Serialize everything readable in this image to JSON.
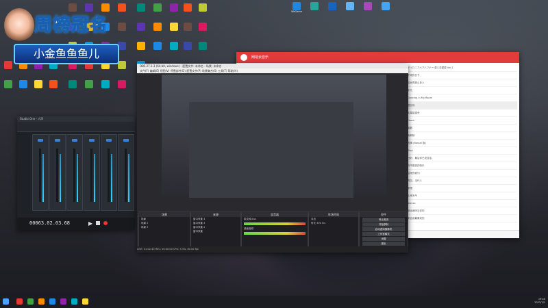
{
  "overlay": {
    "title": "周榜冠名",
    "subtitle": "小金鱼鱼鱼儿"
  },
  "desktop": {
    "top_icons": [
      {
        "label": "WeGame",
        "color": "#1e88e5"
      },
      {
        "label": "",
        "color": "#26a69a"
      },
      {
        "label": "",
        "color": "#1565c0"
      },
      {
        "label": "",
        "color": "#64b5f6"
      },
      {
        "label": "",
        "color": "#ab47bc"
      },
      {
        "label": "",
        "color": "#42a5f5"
      }
    ],
    "left_icon_colors": [
      "#e53935",
      "#43a047",
      "#fb8c00",
      "#1e88e5",
      "#8e24aa",
      "#fdd835",
      "#00acc1",
      "#f4511e",
      "#6d4c41",
      "#3949ab",
      "#c0ca33",
      "#d81b60",
      "#00897b",
      "#5e35b1",
      "#ffb300",
      "#039be5"
    ]
  },
  "studio_one": {
    "title": "Studio One - 人声",
    "time": "00063.02.03.68",
    "channels": 6
  },
  "obs": {
    "title": "OBS 27.1.3 (64-bit, windows) - 配置文件: 未命名 - 场景: 未命名",
    "menu": "文件(F)  编辑(E)  视图(V)  停靠部件(D)  配置文件(P)  场景集合(S)  工具(T)  帮助(H)",
    "docks": {
      "scenes": "场景",
      "sources": "来源",
      "mixer": "混音器",
      "transitions": "转场特效",
      "controls": "控件"
    },
    "scene_items": [
      "场景",
      "场景 2",
      "场景 3"
    ],
    "source_items": [
      "窗口采集 4",
      "窗口采集 3",
      "窗口采集 2",
      "窗口采集"
    ],
    "mixer_tracks": [
      "麦克风/Aux",
      "桌面音频"
    ],
    "transition": {
      "type": "淡出",
      "duration_label": "时长",
      "duration": "300 ms"
    },
    "controls": [
      "停止推流",
      "开始录制",
      "启动虚拟摄像机",
      "工作室模式",
      "设置",
      "退出"
    ],
    "status": "LIVE: 01:02:40    REC: 00:00:00    CPU: 3.3%, 60.00 fps"
  },
  "music": {
    "app_name": "网易云音乐",
    "songs": [
      "アイロニアペアハフナー 愛と恋愛愛 Ver.2",
      "下雨的日子",
      "这世界那么多人",
      "平凡",
      "Dancing in My Room",
      "想见你",
      "如果能重来",
      "Dawn",
      "倒数",
      "安和桥",
      "苦情 (Bassel 版)",
      "Stay",
      "还好，最后你已说没话",
      "你不是真的快乐",
      "后来的我们",
      "再见，当代人",
      "来搭",
      "上岸天气",
      "alonzo",
      "说出我听见你的",
      "来自我最喜欢的"
    ]
  },
  "taskbar": {
    "time": "19:40",
    "date": "2022/1/1"
  }
}
